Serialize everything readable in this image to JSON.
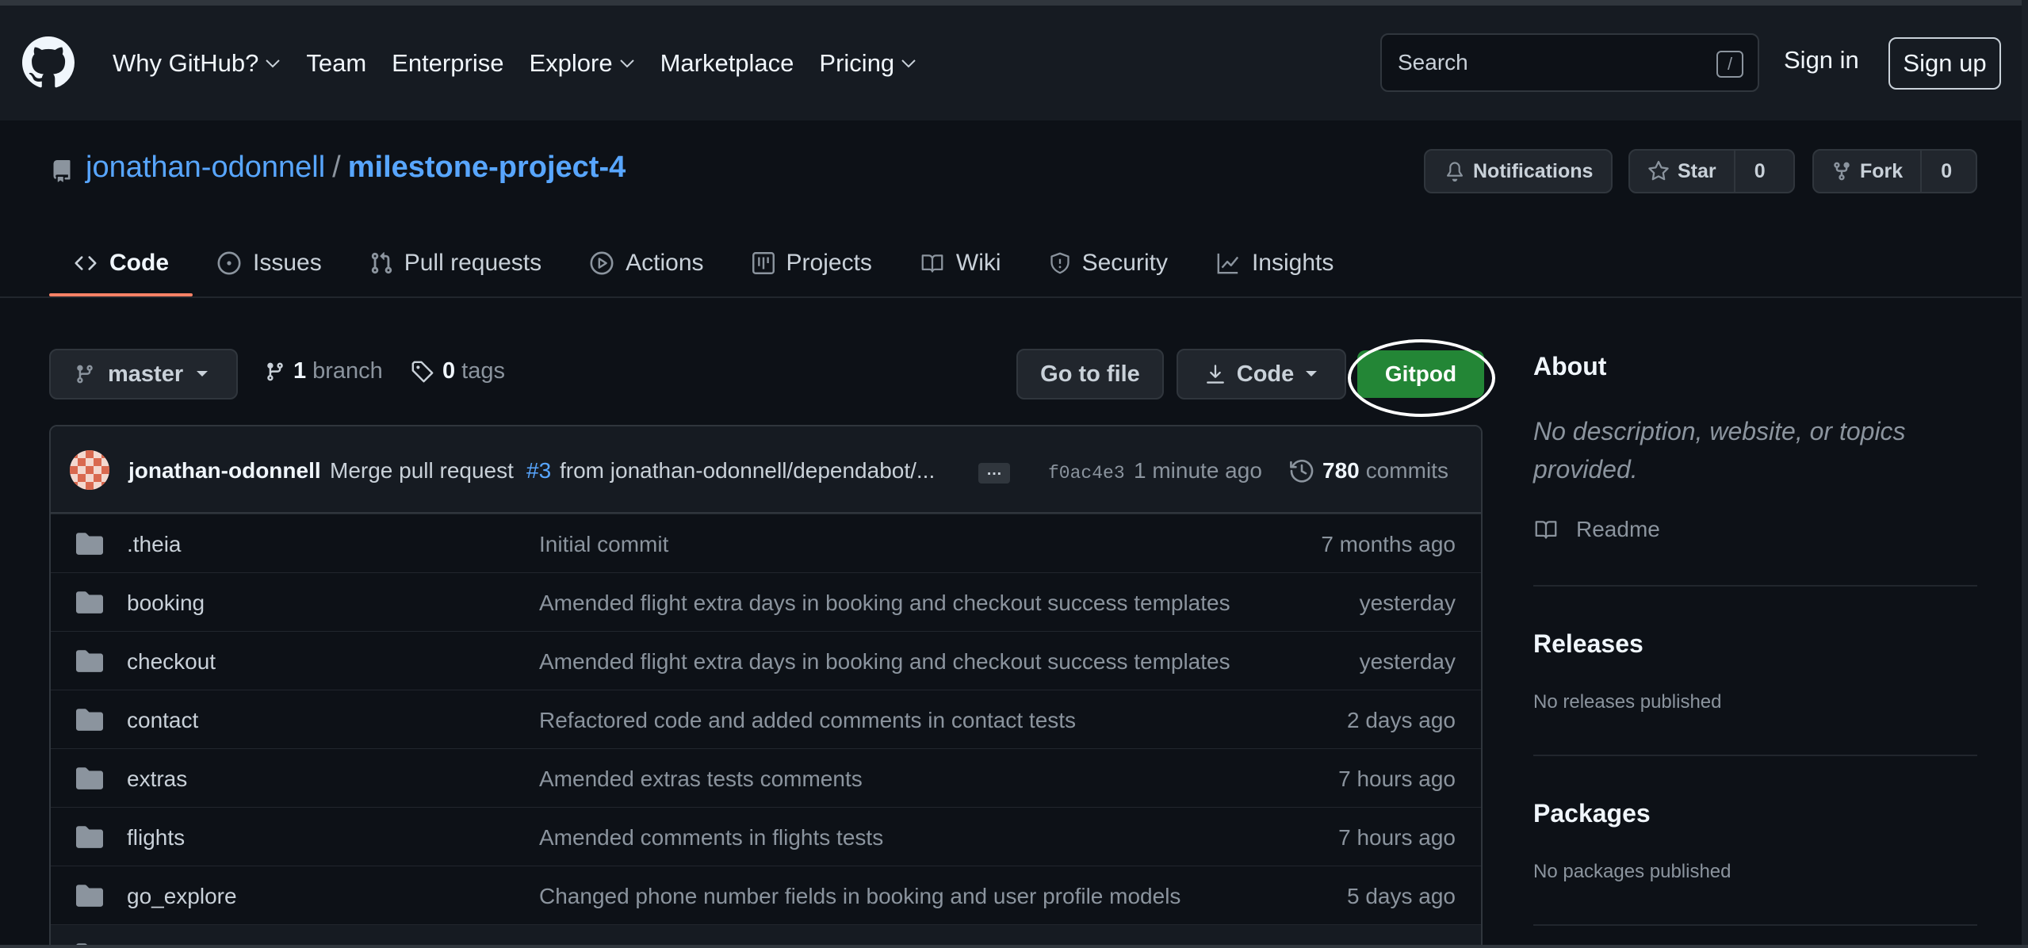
{
  "global_nav": {
    "items": [
      {
        "label": "Why GitHub?",
        "dropdown": true
      },
      {
        "label": "Team",
        "dropdown": false
      },
      {
        "label": "Enterprise",
        "dropdown": false
      },
      {
        "label": "Explore",
        "dropdown": true
      },
      {
        "label": "Marketplace",
        "dropdown": false
      },
      {
        "label": "Pricing",
        "dropdown": true
      }
    ],
    "search_placeholder": "Search",
    "search_shortcut": "/",
    "sign_in": "Sign in",
    "sign_up": "Sign up"
  },
  "repo": {
    "owner": "jonathan-odonnell",
    "separator": "/",
    "name": "milestone-project-4",
    "notifications_label": "Notifications",
    "star_label": "Star",
    "star_count": "0",
    "fork_label": "Fork",
    "fork_count": "0"
  },
  "tabs": [
    {
      "label": "Code",
      "icon": "code-icon",
      "active": true
    },
    {
      "label": "Issues",
      "icon": "issue-icon",
      "active": false
    },
    {
      "label": "Pull requests",
      "icon": "pull-request-icon",
      "active": false
    },
    {
      "label": "Actions",
      "icon": "play-icon",
      "active": false
    },
    {
      "label": "Projects",
      "icon": "project-icon",
      "active": false
    },
    {
      "label": "Wiki",
      "icon": "book-icon",
      "active": false
    },
    {
      "label": "Security",
      "icon": "shield-icon",
      "active": false
    },
    {
      "label": "Insights",
      "icon": "graph-icon",
      "active": false
    }
  ],
  "file_nav": {
    "branch": "master",
    "branches_count": "1",
    "branches_label": "branch",
    "tags_count": "0",
    "tags_label": "tags",
    "go_to_file": "Go to file",
    "code_button": "Code",
    "gitpod_button": "Gitpod"
  },
  "latest_commit": {
    "author": "jonathan-odonnell",
    "message_prefix": "Merge pull request",
    "pr_number": "#3",
    "message_suffix": "from jonathan-odonnell/dependabot/...",
    "ellipsis": "…",
    "sha": "f0ac4e3",
    "time": "1 minute ago",
    "commits_count": "780",
    "commits_label": "commits"
  },
  "files": [
    {
      "name": ".theia",
      "message": "Initial commit",
      "time": "7 months ago"
    },
    {
      "name": "booking",
      "message": "Amended flight extra days in booking and checkout success templates",
      "time": "yesterday"
    },
    {
      "name": "checkout",
      "message": "Amended flight extra days in booking and checkout success templates",
      "time": "yesterday"
    },
    {
      "name": "contact",
      "message": "Refactored code and added comments in contact tests",
      "time": "2 days ago"
    },
    {
      "name": "extras",
      "message": "Amended extras tests comments",
      "time": "7 hours ago"
    },
    {
      "name": "flights",
      "message": "Amended comments in flights tests",
      "time": "7 hours ago"
    },
    {
      "name": "go_explore",
      "message": "Changed phone number fields in booking and user profile models",
      "time": "5 days ago"
    }
  ],
  "sidebar": {
    "about_heading": "About",
    "about_description": "No description, website, or topics provided.",
    "readme_label": "Readme",
    "releases_heading": "Releases",
    "releases_text": "No releases published",
    "packages_heading": "Packages",
    "packages_text": "No packages published"
  },
  "colors": {
    "page_bg": "#0d1117",
    "header_bg": "#161b22",
    "link": "#58a6ff",
    "muted": "#8b949e",
    "accent_tab": "#f78166",
    "gitpod_green": "#238636",
    "border": "#30363d"
  }
}
